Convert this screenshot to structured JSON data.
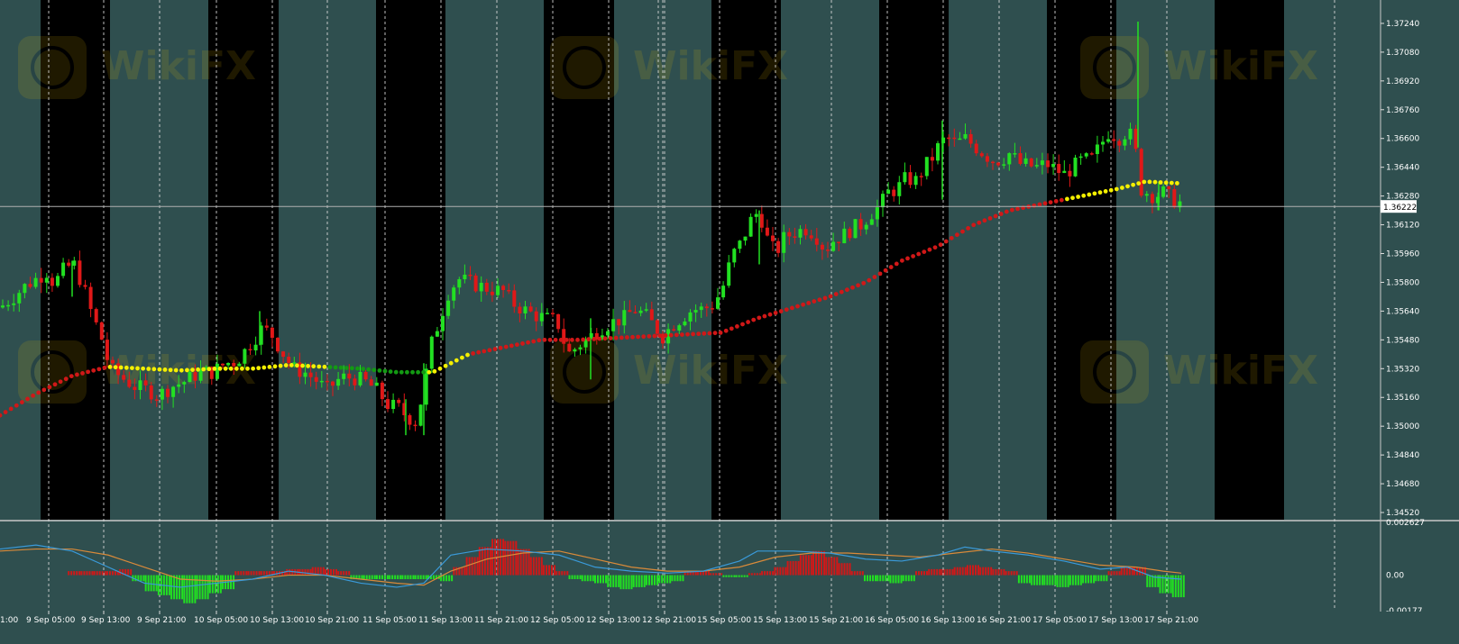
{
  "chart_data": [
    {
      "type": "candlestick",
      "title": "",
      "timeframe": "H1",
      "price_axis_ticks": [
        "1.37240",
        "1.37080",
        "1.36920",
        "1.36760",
        "1.36600",
        "1.36440",
        "1.36280",
        "1.36120",
        "1.35960",
        "1.35800",
        "1.35640",
        "1.35480",
        "1.35320",
        "1.35160",
        "1.35000",
        "1.34840",
        "1.34680",
        "1.34520"
      ],
      "ylim": [
        1.3448,
        1.3737
      ],
      "current_price": "1.36222",
      "time_axis_labels": [
        "9 Sep 05:00",
        "9 Sep 13:00",
        "9 Sep 21:00",
        "10 Sep 05:00",
        "10 Sep 13:00",
        "10 Sep 21:00",
        "11 Sep 05:00",
        "11 Sep 13:00",
        "11 Sep 21:00",
        "12 Sep 05:00",
        "12 Sep 13:00",
        "12 Sep 21:00",
        "15 Sep 05:00",
        "15 Sep 13:00",
        "15 Sep 21:00",
        "16 Sep 05:00",
        "16 Sep 13:00",
        "16 Sep 21:00",
        "17 Sep 05:00",
        "17 Sep 13:00",
        "17 Sep 21:00"
      ],
      "left_cut_label": "1:00",
      "price_path": [
        [
          0,
          1.3566
        ],
        [
          15,
          1.3572
        ],
        [
          28,
          1.3578
        ],
        [
          40,
          1.3582
        ],
        [
          52,
          1.3586
        ],
        [
          60,
          1.3579
        ],
        [
          72,
          1.3588
        ],
        [
          82,
          1.359
        ],
        [
          92,
          1.3578
        ],
        [
          102,
          1.3562
        ],
        [
          112,
          1.355
        ],
        [
          122,
          1.3532
        ],
        [
          135,
          1.3527
        ],
        [
          150,
          1.3522
        ],
        [
          165,
          1.352
        ],
        [
          175,
          1.3517
        ],
        [
          190,
          1.3522
        ],
        [
          205,
          1.3525
        ],
        [
          222,
          1.353
        ],
        [
          236,
          1.353
        ],
        [
          250,
          1.3535
        ],
        [
          262,
          1.3536
        ],
        [
          275,
          1.3544
        ],
        [
          290,
          1.3554
        ],
        [
          300,
          1.3552
        ],
        [
          312,
          1.3542
        ],
        [
          325,
          1.3532
        ],
        [
          338,
          1.353
        ],
        [
          352,
          1.3525
        ],
        [
          362,
          1.352
        ],
        [
          378,
          1.3527
        ],
        [
          392,
          1.3527
        ],
        [
          404,
          1.3525
        ],
        [
          418,
          1.352
        ],
        [
          430,
          1.3512
        ],
        [
          442,
          1.351
        ],
        [
          450,
          1.3506
        ],
        [
          462,
          1.3502
        ],
        [
          470,
          1.3522
        ],
        [
          478,
          1.3545
        ],
        [
          488,
          1.356
        ],
        [
          497,
          1.3574
        ],
        [
          508,
          1.3582
        ],
        [
          520,
          1.358
        ],
        [
          532,
          1.3578
        ],
        [
          545,
          1.3576
        ],
        [
          558,
          1.3575
        ],
        [
          570,
          1.3568
        ],
        [
          580,
          1.3565
        ],
        [
          592,
          1.3562
        ],
        [
          605,
          1.356
        ],
        [
          618,
          1.3558
        ],
        [
          630,
          1.354
        ],
        [
          642,
          1.3545
        ],
        [
          655,
          1.355
        ],
        [
          668,
          1.3555
        ],
        [
          680,
          1.3558
        ],
        [
          692,
          1.356
        ],
        [
          703,
          1.3565
        ],
        [
          715,
          1.3562
        ],
        [
          725,
          1.3556
        ],
        [
          735,
          1.355
        ],
        [
          745,
          1.3556
        ],
        [
          755,
          1.356
        ],
        [
          768,
          1.3565
        ],
        [
          780,
          1.3565
        ],
        [
          792,
          1.3568
        ],
        [
          802,
          1.3578
        ],
        [
          812,
          1.3595
        ],
        [
          822,
          1.3602
        ],
        [
          832,
          1.3614
        ],
        [
          842,
          1.362
        ],
        [
          850,
          1.3605
        ],
        [
          860,
          1.3596
        ],
        [
          870,
          1.3605
        ],
        [
          882,
          1.3608
        ],
        [
          895,
          1.361
        ],
        [
          905,
          1.3606
        ],
        [
          915,
          1.3598
        ],
        [
          925,
          1.3604
        ],
        [
          935,
          1.3606
        ],
        [
          945,
          1.361
        ],
        [
          955,
          1.3612
        ],
        [
          965,
          1.3618
        ],
        [
          975,
          1.3622
        ],
        [
          985,
          1.363
        ],
        [
          995,
          1.3632
        ],
        [
          1005,
          1.3638
        ],
        [
          1015,
          1.3636
        ],
        [
          1025,
          1.3644
        ],
        [
          1035,
          1.365
        ],
        [
          1043,
          1.3658
        ],
        [
          1052,
          1.366
        ],
        [
          1060,
          1.3657
        ],
        [
          1070,
          1.366
        ],
        [
          1080,
          1.3656
        ],
        [
          1090,
          1.3652
        ],
        [
          1100,
          1.3648
        ],
        [
          1110,
          1.3648
        ],
        [
          1120,
          1.3652
        ],
        [
          1130,
          1.3646
        ],
        [
          1140,
          1.3645
        ],
        [
          1150,
          1.3644
        ],
        [
          1160,
          1.3646
        ],
        [
          1170,
          1.3643
        ],
        [
          1180,
          1.364
        ],
        [
          1190,
          1.3644
        ],
        [
          1200,
          1.3648
        ],
        [
          1210,
          1.3648
        ],
        [
          1220,
          1.3656
        ],
        [
          1230,
          1.3664
        ],
        [
          1240,
          1.366
        ],
        [
          1250,
          1.3664
        ],
        [
          1258,
          1.3659
        ],
        [
          1264,
          1.3632
        ],
        [
          1272,
          1.363
        ],
        [
          1280,
          1.3628
        ],
        [
          1290,
          1.363
        ],
        [
          1300,
          1.3626
        ],
        [
          1310,
          1.3624
        ]
      ],
      "spikes": [
        [
          1262,
          1.3725,
          1.3655
        ],
        [
          1045,
          1.367,
          1.3626
        ],
        [
          1285,
          1.3636,
          1.362
        ],
        [
          842,
          1.362,
          1.359
        ],
        [
          450,
          1.3515,
          1.3495
        ],
        [
          470,
          1.3535,
          1.3495
        ],
        [
          80,
          1.3592,
          1.3572
        ],
        [
          288,
          1.3564,
          1.3545
        ],
        [
          655,
          1.356,
          1.3526
        ]
      ],
      "moving_average": {
        "ylim_points": [
          [
            0,
            1.3506
          ],
          [
            40,
            1.3518
          ],
          [
            80,
            1.3528
          ],
          [
            120,
            1.3533
          ],
          [
            160,
            1.3532
          ],
          [
            200,
            1.3531
          ],
          [
            240,
            1.3532
          ],
          [
            280,
            1.3532
          ],
          [
            320,
            1.3534
          ],
          [
            360,
            1.3533
          ],
          [
            400,
            1.3532
          ],
          [
            440,
            1.353
          ],
          [
            480,
            1.353
          ],
          [
            520,
            1.354
          ],
          [
            560,
            1.3544
          ],
          [
            600,
            1.3548
          ],
          [
            640,
            1.3548
          ],
          [
            680,
            1.3549
          ],
          [
            720,
            1.355
          ],
          [
            760,
            1.3551
          ],
          [
            800,
            1.3552
          ],
          [
            840,
            1.356
          ],
          [
            880,
            1.3566
          ],
          [
            920,
            1.3572
          ],
          [
            960,
            1.358
          ],
          [
            1000,
            1.3592
          ],
          [
            1040,
            1.36
          ],
          [
            1080,
            1.3612
          ],
          [
            1120,
            1.362
          ],
          [
            1160,
            1.3624
          ],
          [
            1200,
            1.3628
          ],
          [
            1240,
            1.3632
          ],
          [
            1270,
            1.3636
          ],
          [
            1310,
            1.3635
          ]
        ],
        "segments": [
          {
            "from": 0,
            "to": 120,
            "color": "#d01818"
          },
          {
            "from": 120,
            "to": 362,
            "color": "#f5f000"
          },
          {
            "from": 362,
            "to": 475,
            "color": "#139a13"
          },
          {
            "from": 475,
            "to": 520,
            "color": "#f5f000"
          },
          {
            "from": 520,
            "to": 1180,
            "color": "#d01818"
          },
          {
            "from": 1180,
            "to": 1265,
            "color": "#f5f000"
          },
          {
            "from": 1265,
            "to": 1310,
            "color": "#f5f000"
          }
        ]
      }
    },
    {
      "type": "histogram",
      "title": "",
      "indicator": "MACD",
      "axis_ticks": [
        "0.002627",
        "0.00",
        "-0.00177"
      ],
      "ylim": [
        -0.00177,
        0.002627
      ],
      "histogram": [
        0,
        0,
        0,
        0,
        0,
        0.0002,
        0.0002,
        0.0002,
        0.0002,
        0.0003,
        -0.0003,
        -0.0008,
        -0.001,
        -0.0012,
        -0.0014,
        -0.0012,
        -0.0009,
        -0.0007,
        0.0002,
        0.0002,
        0.0002,
        0.0002,
        0.0003,
        0.0003,
        0.0004,
        0.0003,
        0.0002,
        -0.0002,
        -0.0002,
        -0.0002,
        -0.0002,
        -0.0002,
        -0.0002,
        -0.0002,
        -0.0003,
        0.0004,
        0.0009,
        0.0014,
        0.0018,
        0.0017,
        0.0013,
        0.0009,
        0.0005,
        0.0002,
        -0.0002,
        -0.0003,
        -0.0004,
        -0.0006,
        -0.0007,
        -0.0006,
        -0.0005,
        -0.0004,
        -0.0003,
        0.0002,
        0.0002,
        0.0001,
        -0.0001,
        -0.0001,
        0.0001,
        0.0002,
        0.0004,
        0.0007,
        0.001,
        0.0012,
        0.0009,
        0.0006,
        0.0002,
        -0.0003,
        -0.0003,
        -0.0004,
        -0.0003,
        0.0002,
        0.0003,
        0.0003,
        0.0004,
        0.0005,
        0.0004,
        0.0003,
        0.0002,
        -0.0004,
        -0.0005,
        -0.0005,
        -0.0006,
        -0.0005,
        -0.0004,
        -0.0003,
        0.0002,
        0.0004,
        0.0004,
        -0.0006,
        -0.0009,
        -0.0011
      ],
      "macd_line": [
        [
          0,
          0.0013
        ],
        [
          40,
          0.0015
        ],
        [
          80,
          0.0012
        ],
        [
          120,
          0.0004
        ],
        [
          160,
          -0.0004
        ],
        [
          200,
          -0.0006
        ],
        [
          240,
          -0.0004
        ],
        [
          280,
          -0.0002
        ],
        [
          320,
          0.0002
        ],
        [
          360,
          0.0
        ],
        [
          400,
          -0.0004
        ],
        [
          440,
          -0.0006
        ],
        [
          470,
          -0.0004
        ],
        [
          500,
          0.001
        ],
        [
          540,
          0.0013
        ],
        [
          580,
          0.0012
        ],
        [
          620,
          0.001
        ],
        [
          660,
          0.0004
        ],
        [
          700,
          0.0002
        ],
        [
          740,
          0.0001
        ],
        [
          780,
          0.0002
        ],
        [
          820,
          0.0007
        ],
        [
          840,
          0.0012
        ],
        [
          880,
          0.0012
        ],
        [
          920,
          0.0011
        ],
        [
          960,
          0.0008
        ],
        [
          1000,
          0.0007
        ],
        [
          1040,
          0.001
        ],
        [
          1070,
          0.0014
        ],
        [
          1100,
          0.0012
        ],
        [
          1140,
          0.001
        ],
        [
          1180,
          0.0007
        ],
        [
          1220,
          0.0003
        ],
        [
          1250,
          0.0004
        ],
        [
          1280,
          -0.0001
        ],
        [
          1310,
          -0.0002
        ]
      ],
      "signal_line": [
        [
          0,
          0.0012
        ],
        [
          40,
          0.0013
        ],
        [
          80,
          0.0013
        ],
        [
          120,
          0.001
        ],
        [
          160,
          0.0004
        ],
        [
          200,
          -0.0002
        ],
        [
          240,
          -0.0003
        ],
        [
          280,
          -0.0002
        ],
        [
          320,
          0.0
        ],
        [
          360,
          0.0
        ],
        [
          400,
          -0.0002
        ],
        [
          440,
          -0.0004
        ],
        [
          470,
          -0.0005
        ],
        [
          500,
          0.0002
        ],
        [
          540,
          0.0008
        ],
        [
          580,
          0.0011
        ],
        [
          620,
          0.0012
        ],
        [
          660,
          0.0008
        ],
        [
          700,
          0.0004
        ],
        [
          740,
          0.0002
        ],
        [
          780,
          0.0002
        ],
        [
          820,
          0.0004
        ],
        [
          860,
          0.0009
        ],
        [
          900,
          0.0011
        ],
        [
          940,
          0.0011
        ],
        [
          980,
          0.001
        ],
        [
          1020,
          0.0009
        ],
        [
          1060,
          0.0011
        ],
        [
          1100,
          0.0013
        ],
        [
          1140,
          0.0011
        ],
        [
          1180,
          0.0008
        ],
        [
          1220,
          0.0005
        ],
        [
          1260,
          0.0004
        ],
        [
          1290,
          0.0002
        ],
        [
          1310,
          0.0001
        ]
      ]
    }
  ],
  "colors": {
    "background_light": "#2f4f4f",
    "background_dark": "#000000",
    "bull": "#22e022",
    "bear": "#e01818",
    "macd_line": "#3a9ad9",
    "signal_line": "#d98a3a",
    "hist_pos": "#d01818",
    "hist_neg": "#22e022",
    "axis_text": "#ffffff",
    "grid": "#dddddd"
  },
  "watermark": "WikiFX"
}
